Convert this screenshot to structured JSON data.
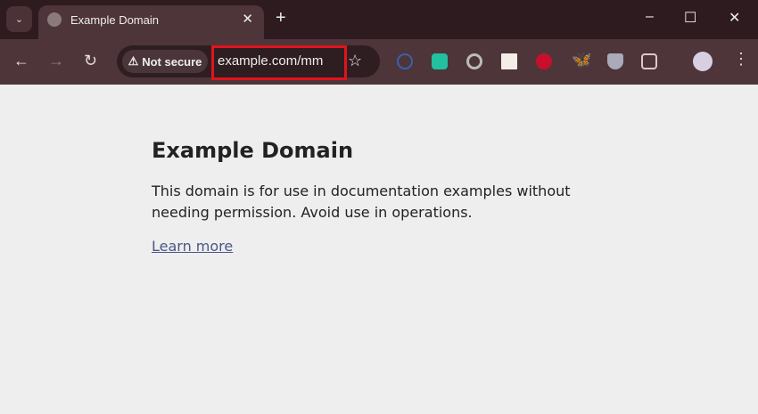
{
  "tab": {
    "title": "Example Domain"
  },
  "window": {
    "minimize": "–",
    "maximize": "☐",
    "close": "✕"
  },
  "omnibox": {
    "security": "Not secure",
    "url": "example.com/mm"
  },
  "page": {
    "heading": "Example Domain",
    "body": "This domain is for use in documentation examples without needing permission. Avoid use in operations.",
    "link": "Learn more"
  },
  "colors": {
    "highlight": "#e0141c",
    "link": "#4a5787"
  }
}
